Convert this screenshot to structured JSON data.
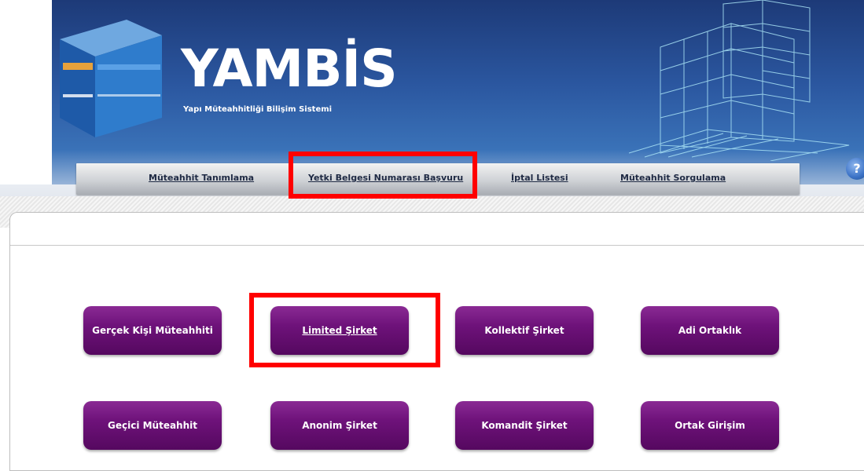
{
  "logo": {
    "title": "YAMBİS",
    "subtitle": "Yapı Müteahhitliği Bilişim Sistemi"
  },
  "nav": {
    "items": [
      {
        "label": "Müteahhit Tanımlama"
      },
      {
        "label": "Yetki Belgesi Numarası Başvuru"
      },
      {
        "label": "İptal Listesi"
      },
      {
        "label": "Müteahhit Sorgulama"
      }
    ]
  },
  "help": {
    "glyph": "?"
  },
  "buttons": [
    {
      "label": "Gerçek Kişi Müteahhiti"
    },
    {
      "label": "Limited Şirket"
    },
    {
      "label": "Kollektif Şirket"
    },
    {
      "label": "Adi Ortaklık"
    },
    {
      "label": "Geçici Müteahhit"
    },
    {
      "label": "Anonim Şirket"
    },
    {
      "label": "Komandit Şirket"
    },
    {
      "label": "Ortak Girişim"
    }
  ],
  "colors": {
    "header": "#2b57a0",
    "button": "#6e127a",
    "highlight": "#ff0000"
  }
}
